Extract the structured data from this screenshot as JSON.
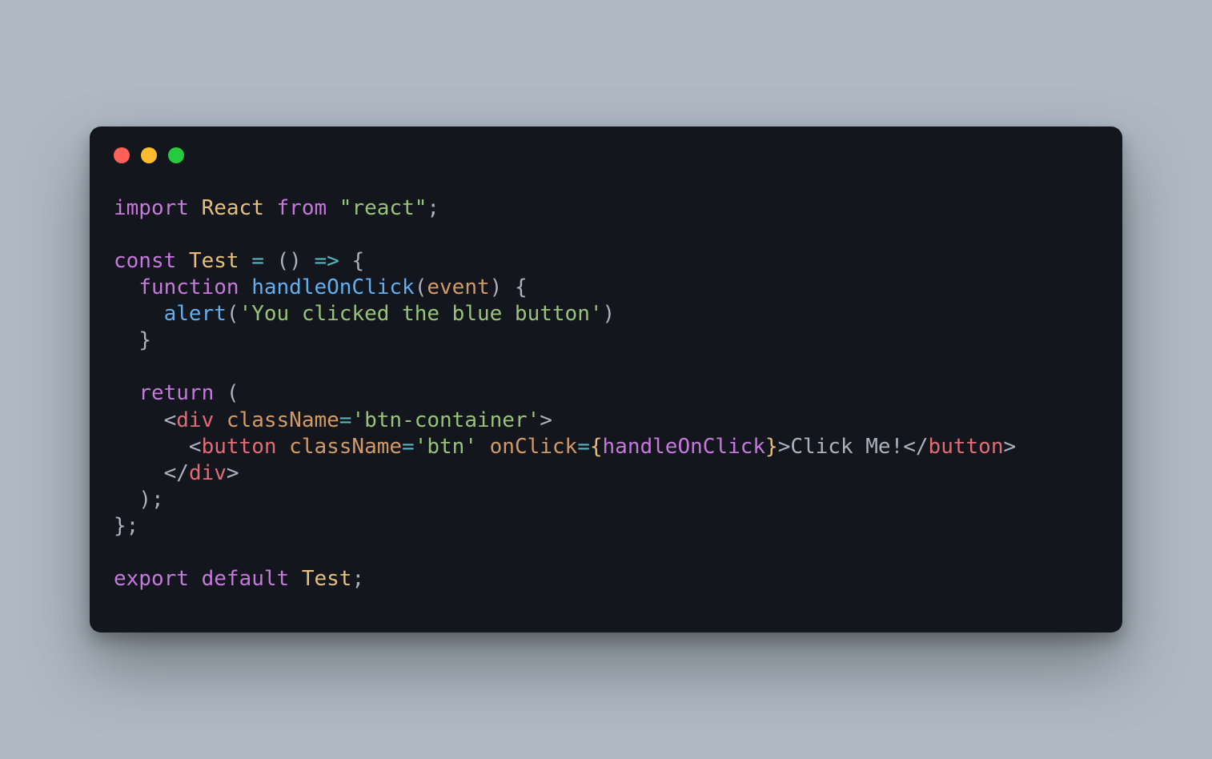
{
  "tokens": {
    "t1": "import",
    "t2": "React",
    "t3": "from",
    "t4": "\"react\"",
    "t5": ";",
    "t6": "const",
    "t7": "Test",
    "t8": "=",
    "t9": "()",
    "t10": "=>",
    "t11": "{",
    "t12": "function",
    "t13": "handleOnClick",
    "t14": "(",
    "t15": "event",
    "t16": ")",
    "t17": "{",
    "t18": "alert",
    "t19": "(",
    "t20": "'You clicked the blue button'",
    "t21": ")",
    "t22": "}",
    "t23": "return",
    "t24": "(",
    "t25": "<",
    "t26": "div",
    "t27": "className",
    "t28": "=",
    "t29": "'btn-container'",
    "t30": ">",
    "t31": "<",
    "t32": "button",
    "t33": "className",
    "t34": "=",
    "t35": "'btn'",
    "t36": "onClick",
    "t37": "=",
    "t38": "{",
    "t39": "handleOnClick",
    "t40": "}",
    "t41": ">",
    "t42": "Click Me!",
    "t43": "</",
    "t44": "button",
    "t45": ">",
    "t46": "</",
    "t47": "div",
    "t48": ">",
    "t49": ");",
    "t50": "};",
    "t51": "export",
    "t52": "default",
    "t53": "Test",
    "t54": ";"
  }
}
